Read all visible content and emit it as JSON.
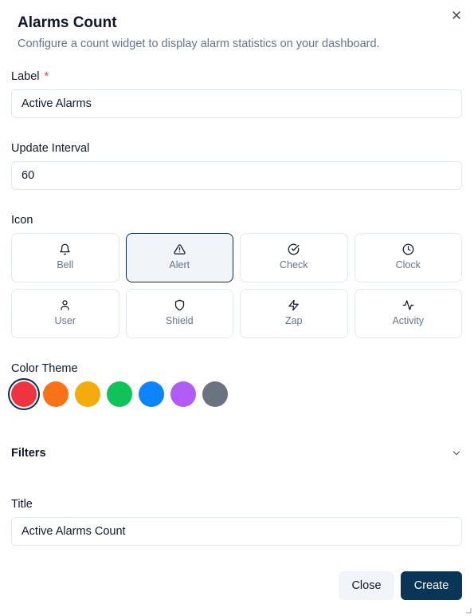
{
  "dialog": {
    "title": "Alarms Count",
    "description": "Configure a count widget to display alarm statistics on your dashboard.",
    "close_icon": "close-icon"
  },
  "form": {
    "label": {
      "label": "Label",
      "required_mark": "*",
      "value": "Active Alarms"
    },
    "update_interval": {
      "label": "Update Interval",
      "value": "60"
    },
    "icon": {
      "label": "Icon",
      "selected": "Alert",
      "options": [
        {
          "label": "Bell",
          "icon": "bell-icon"
        },
        {
          "label": "Alert",
          "icon": "alert-triangle-icon"
        },
        {
          "label": "Check",
          "icon": "check-circle-icon"
        },
        {
          "label": "Clock",
          "icon": "clock-icon"
        },
        {
          "label": "User",
          "icon": "user-icon"
        },
        {
          "label": "Shield",
          "icon": "shield-icon"
        },
        {
          "label": "Zap",
          "icon": "zap-icon"
        },
        {
          "label": "Activity",
          "icon": "activity-icon"
        }
      ]
    },
    "color_theme": {
      "label": "Color Theme",
      "selected": "#ef3340",
      "colors": [
        "#ef3340",
        "#f97316",
        "#f5ab0b",
        "#0fc35b",
        "#0a84ff",
        "#b25cf6",
        "#6b7280"
      ]
    },
    "filters": {
      "label": "Filters",
      "icon": "chevron-down-icon"
    },
    "title": {
      "label": "Title",
      "value": "Active Alarms Count"
    }
  },
  "actions": {
    "close_label": "Close",
    "create_label": "Create"
  },
  "colors": {
    "primary": "#0b3557",
    "muted_text": "#64748b",
    "border": "#e2e8f0",
    "required": "#ef4444"
  }
}
